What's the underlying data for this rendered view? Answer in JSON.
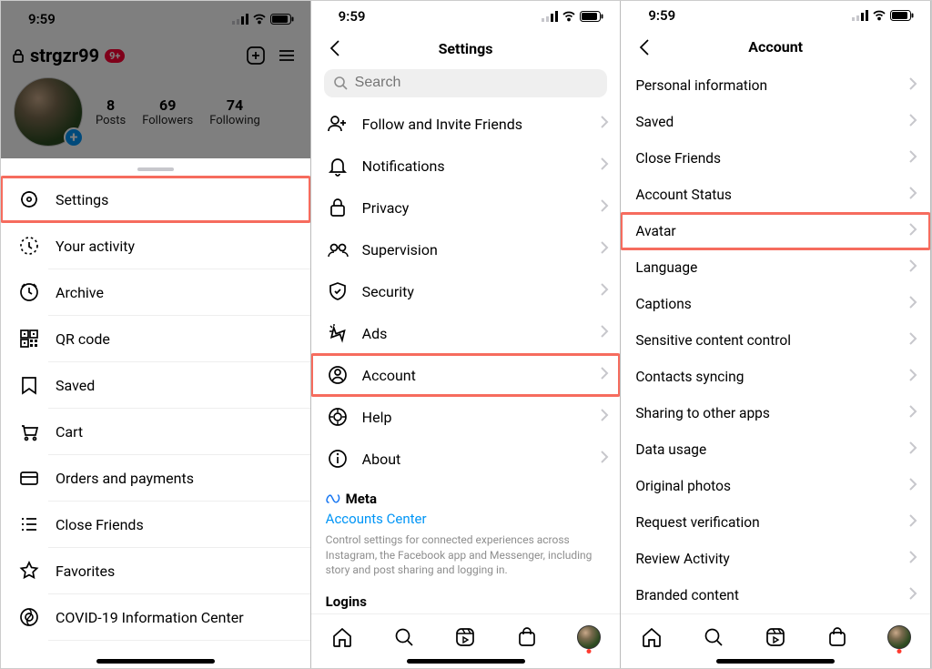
{
  "status": {
    "time": "9:59"
  },
  "panel1": {
    "username": "strgzr99",
    "badge": "9+",
    "stats": [
      {
        "num": "8",
        "label": "Posts"
      },
      {
        "num": "69",
        "label": "Followers"
      },
      {
        "num": "74",
        "label": "Following"
      }
    ],
    "menu": [
      {
        "label": "Settings",
        "highlight": true
      },
      {
        "label": "Your activity"
      },
      {
        "label": "Archive"
      },
      {
        "label": "QR code"
      },
      {
        "label": "Saved"
      },
      {
        "label": "Cart"
      },
      {
        "label": "Orders and payments"
      },
      {
        "label": "Close Friends"
      },
      {
        "label": "Favorites"
      },
      {
        "label": "COVID-19 Information Center"
      }
    ]
  },
  "panel2": {
    "title": "Settings",
    "search_placeholder": "Search",
    "items": [
      {
        "label": "Follow and Invite Friends"
      },
      {
        "label": "Notifications"
      },
      {
        "label": "Privacy"
      },
      {
        "label": "Supervision"
      },
      {
        "label": "Security"
      },
      {
        "label": "Ads"
      },
      {
        "label": "Account",
        "highlight": true
      },
      {
        "label": "Help"
      },
      {
        "label": "About"
      }
    ],
    "meta": {
      "brand": "Meta",
      "link": "Accounts Center",
      "desc": "Control settings for connected experiences across Instagram, the Facebook app and Messenger, including story and post sharing and logging in."
    },
    "logins_header": "Logins"
  },
  "panel3": {
    "title": "Account",
    "items": [
      {
        "label": "Personal information"
      },
      {
        "label": "Saved"
      },
      {
        "label": "Close Friends"
      },
      {
        "label": "Account Status"
      },
      {
        "label": "Avatar",
        "highlight": true
      },
      {
        "label": "Language"
      },
      {
        "label": "Captions"
      },
      {
        "label": "Sensitive content control"
      },
      {
        "label": "Contacts syncing"
      },
      {
        "label": "Sharing to other apps"
      },
      {
        "label": "Data usage"
      },
      {
        "label": "Original photos"
      },
      {
        "label": "Request verification"
      },
      {
        "label": "Review Activity"
      },
      {
        "label": "Branded content"
      }
    ]
  }
}
